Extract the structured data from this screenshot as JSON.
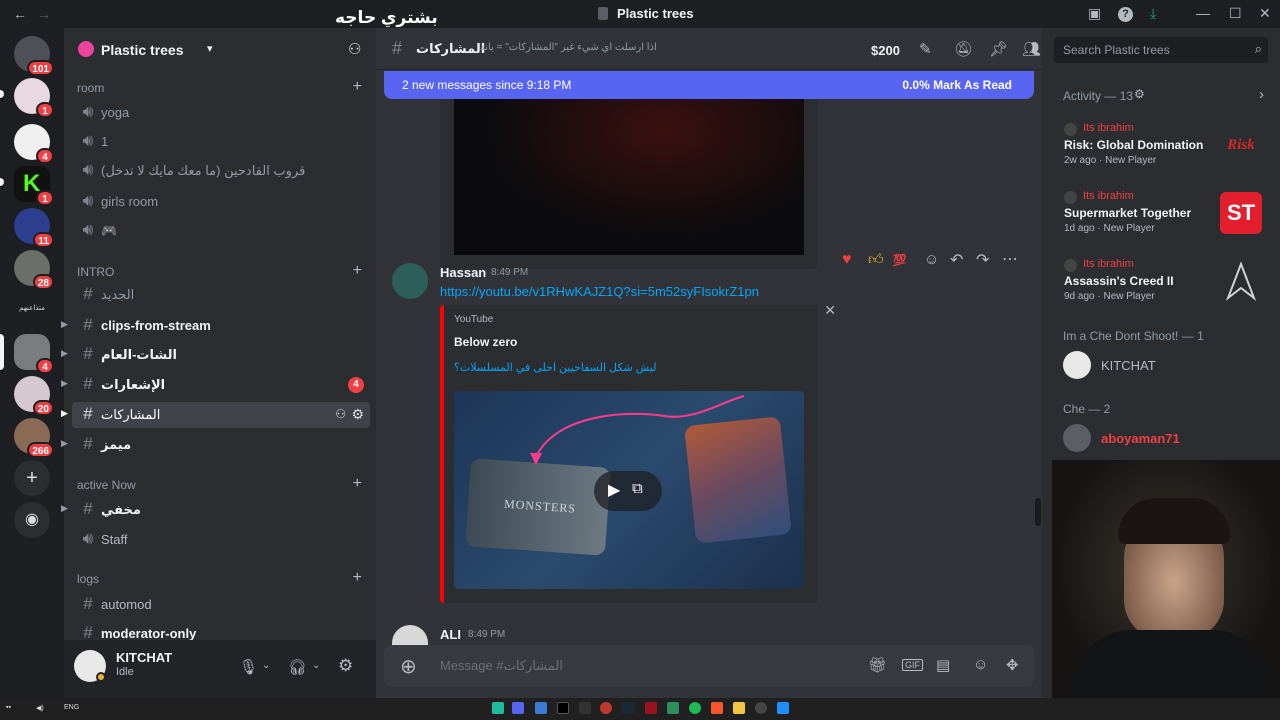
{
  "titlebar": {
    "title": "Plastic trees",
    "overlay_text": "بشتري حاجه"
  },
  "rail": {
    "badges": [
      "101",
      "1",
      "4",
      "1",
      "11",
      "28",
      "4",
      "20",
      "266"
    ],
    "text_server": "متذاعنهم"
  },
  "guild": {
    "name": "Plastic trees"
  },
  "categories": {
    "room": "room",
    "intro": "INTRO",
    "active": "active Now",
    "logs": "logs"
  },
  "channels": {
    "yoga": "yoga",
    "one": "1",
    "qadimin": "قروب القادحين (ما معك مايك لا تدخل)",
    "girls": "girls room",
    "game": "🎮",
    "jadeed": "الجديد",
    "clips": "clips-from-stream",
    "chat_aam": "الشات-العام",
    "ishaarat": "الإشعارات",
    "ishaarat_badge": "4",
    "musharakat": "المشاركات",
    "mumayaz": "ميمز",
    "mukhfi": "مخفي",
    "staff": "Staff",
    "automod": "automod",
    "moderator": "moderator-only"
  },
  "user": {
    "name": "KITCHAT",
    "status": "Idle"
  },
  "chat": {
    "channel_name": "المشاركات",
    "topic": "اذا ارسلت اي شيء غير \"المشاركات\" = باند",
    "money": "$200",
    "new_messages": "2 new messages since 9:18 PM",
    "mark_read": "0.0% Mark As Read",
    "msg1_author": "Hassan",
    "msg1_time": "8:49 PM",
    "msg1_link": "https://youtu.be/v1RHwKAJZ1Q?si=5m52syFIsokrZ1pn",
    "embed_provider": "YouTube",
    "embed_title": "Below zero",
    "embed_desc": "ليش شكل السفاحيين احلى في المسلسلات؟",
    "thumb_text": "MONSTERS",
    "msg2_author": "ALI",
    "msg2_time": "8:49 PM",
    "composer_placeholder": "Message #المشاركات",
    "gif": "GIF"
  },
  "rpanel": {
    "search_placeholder": "Search Plastic trees",
    "activity_header": "Activity — 13",
    "activities": [
      {
        "who": "Its ibrahim",
        "game": "Risk: Global Domination",
        "meta": "2w ago · New Player",
        "icon_text": "Risk"
      },
      {
        "who": "Its ibrahim",
        "game": "Supermarket Together",
        "meta": "1d ago · New Player",
        "icon_text": "ST"
      },
      {
        "who": "Its ibrahim",
        "game": "Assassin's Creed II",
        "meta": "9d ago · New Player",
        "icon_text": ""
      }
    ],
    "section1": "Im a Che Dont Shoot! — 1",
    "member1": "KITCHAT",
    "section2": "Che — 2",
    "member2": "aboyaman71"
  },
  "taskbar": {
    "lang": "ENG"
  },
  "colors": {
    "accent": "#5865f2",
    "danger": "#f23f43",
    "link": "#00a8fc",
    "youtube": "#ff0000"
  }
}
